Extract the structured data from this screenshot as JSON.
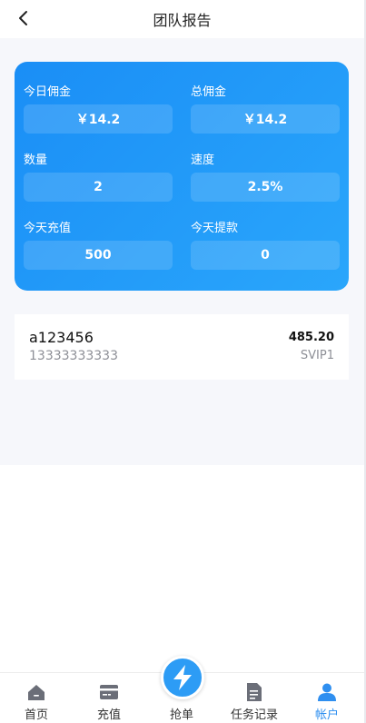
{
  "header": {
    "title": "团队报告"
  },
  "stats": [
    {
      "label": "今日佣金",
      "value": "￥14.2"
    },
    {
      "label": "总佣金",
      "value": "￥14.2"
    },
    {
      "label": "数量",
      "value": "2"
    },
    {
      "label": "速度",
      "value": "2.5%"
    },
    {
      "label": "今天充值",
      "value": "500"
    },
    {
      "label": "今天提款",
      "value": "0"
    }
  ],
  "member": {
    "name": "a123456",
    "phone": "13333333333",
    "amount": "485.20",
    "level": "SVIP1"
  },
  "tabbar": {
    "items": [
      {
        "label": "首页",
        "icon": "home-icon"
      },
      {
        "label": "充值",
        "icon": "card-icon"
      },
      {
        "label": "抢单",
        "icon": "lightning-icon"
      },
      {
        "label": "任务记录",
        "icon": "document-icon"
      },
      {
        "label": "帐户",
        "icon": "user-icon"
      }
    ],
    "active_index": 4
  },
  "colors": {
    "accent": "#2f8ff0",
    "card_gradient_start": "#1a8ef6",
    "card_gradient_end": "#2aa6fb",
    "background": "#f6f7fb"
  }
}
